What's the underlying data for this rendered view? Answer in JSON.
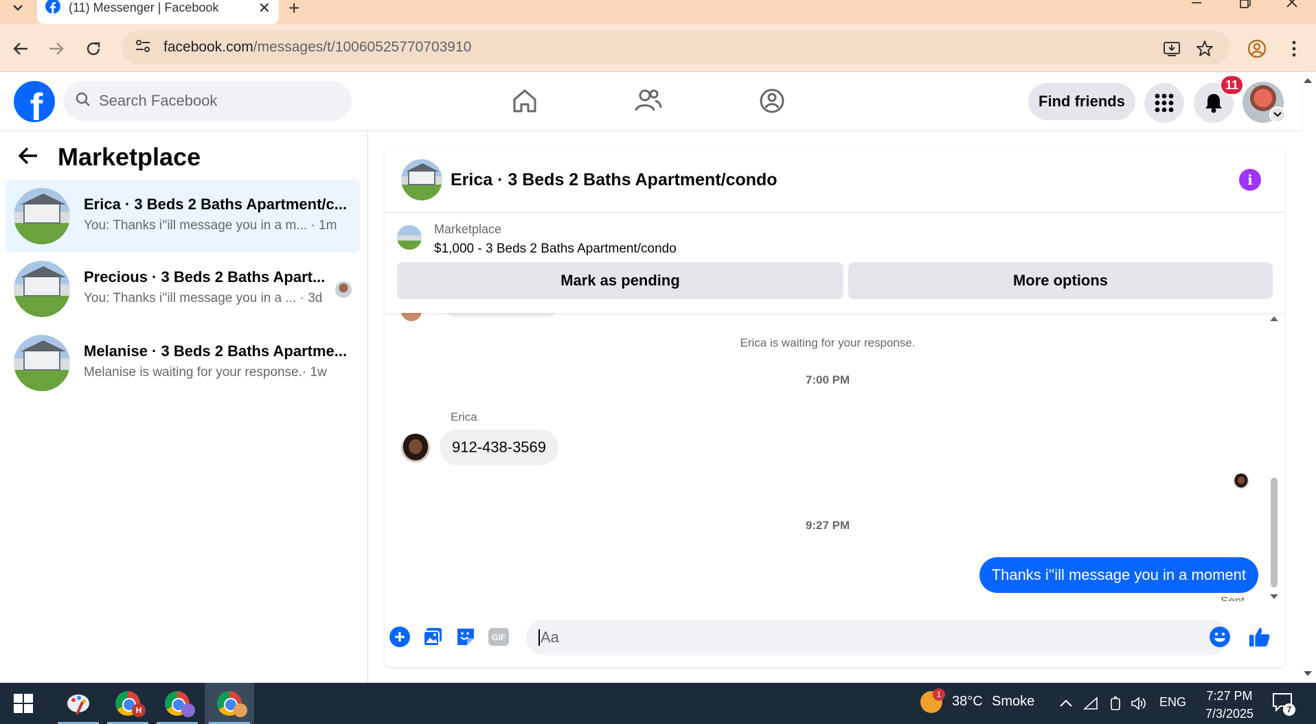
{
  "browser": {
    "tab_title": "(11) Messenger | Facebook",
    "url_host": "facebook.com",
    "url_path": "/messages/t/10060525770703910"
  },
  "fb_header": {
    "search_placeholder": "Search Facebook",
    "find_friends_label": "Find friends",
    "notifications_count": "11"
  },
  "left_pane": {
    "title": "Marketplace",
    "conversations": [
      {
        "name": "Erica · 3 Beds 2 Baths Apartment/c...",
        "preview": "You: Thanks i''ill message you in a m...",
        "time": "· 1m",
        "active": true
      },
      {
        "name": "Precious · 3 Beds 2 Baths Apart...",
        "preview": "You: Thanks i''ill message you in a ...",
        "time": "· 3d",
        "active": false
      },
      {
        "name": "Melanise · 3 Beds 2 Baths Apartme...",
        "preview": "Melanise is waiting for your response.",
        "time": "· 1w",
        "active": false
      }
    ]
  },
  "chat": {
    "title": "Erica · 3 Beds 2 Baths Apartment/condo",
    "listing_label": "Marketplace",
    "listing_price": "$1,000 - 3 Beds 2 Baths Apartment/condo",
    "mark_pending_label": "Mark as pending",
    "more_options_label": "More options",
    "waiting_text": "Erica is waiting for your response.",
    "time_1": "7:00 PM",
    "sender_name": "Erica",
    "incoming_message": "912-438-3569",
    "time_2": "9:27 PM",
    "outgoing_message": "Thanks i''ill message you in a moment",
    "sent_label": "Sent",
    "composer_placeholder": "Aa",
    "gif_label": "GIF"
  },
  "taskbar": {
    "weather_temp": "38°C",
    "weather_desc": "Smoke",
    "weather_badge": "1",
    "language": "ENG",
    "time": "7:27 PM",
    "date": "7/3/2025",
    "notifications_badge": "7",
    "task_app_badge": "H"
  },
  "colors": {
    "fb_blue": "#0866ff",
    "messenger_purple": "#a033ff",
    "notification_red": "#e41e3f",
    "active_conversation_bg": "#ebf5ff"
  }
}
